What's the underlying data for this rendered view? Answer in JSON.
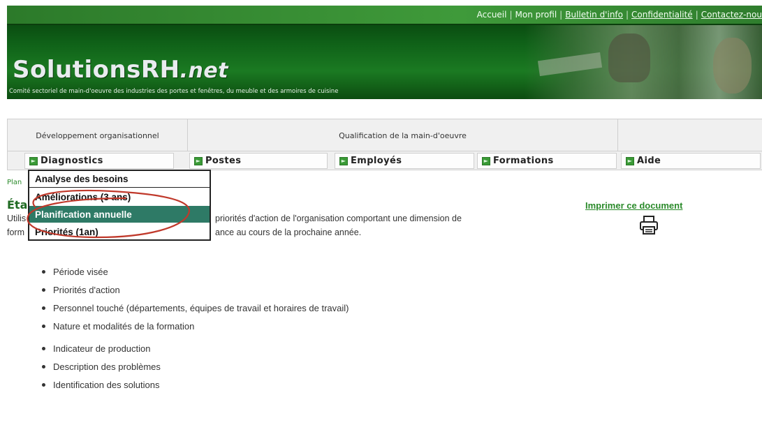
{
  "top_links": [
    "Accueil",
    "Mon profil",
    "Bulletin d'info",
    "Confidentialité",
    "Contactez-nou"
  ],
  "logo": {
    "main": "SolutionsRH",
    "suffix": ".net"
  },
  "tagline": "Comité sectoriel de main-d'oeuvre des industries des portes et fenêtres, du meuble et des armoires de cuisine",
  "nav": {
    "row1": [
      "Développement organisationnel",
      "Qualification de la main-d'oeuvre",
      ""
    ],
    "tabs": [
      "Diagnostics",
      "Postes",
      "Employés",
      "Formations",
      "Aide"
    ]
  },
  "breadcrumb": "Plan",
  "page_title": "Éta",
  "intro": {
    "line1_left": "Utilis",
    "line1_right": "priorités d'action de l'organisation comportant une dimension de",
    "line2_left": "form",
    "line2_right": "ance au cours de la prochaine année."
  },
  "dropdown": {
    "items": [
      "Analyse des besoins",
      "Améliorations (3 ans)",
      "Planification annuelle",
      "Priorités (1an)"
    ],
    "active": "Planification annuelle"
  },
  "print_link": "Imprimer ce document",
  "list_a": [
    "Période visée",
    "Priorités d'action",
    "Personnel touché (départements, équipes de travail et horaires de travail)",
    "Nature et modalités de la formation"
  ],
  "list_b": [
    "Indicateur de production",
    "Description des problèmes",
    "Identification des solutions"
  ],
  "colors": {
    "brand_green": "#1b7a22",
    "active_item": "#2e7a66",
    "link_green": "#2a8a2a",
    "highlight_circle": "#c0392b"
  },
  "icons": [
    "arrow-right-icon",
    "printer-icon"
  ]
}
